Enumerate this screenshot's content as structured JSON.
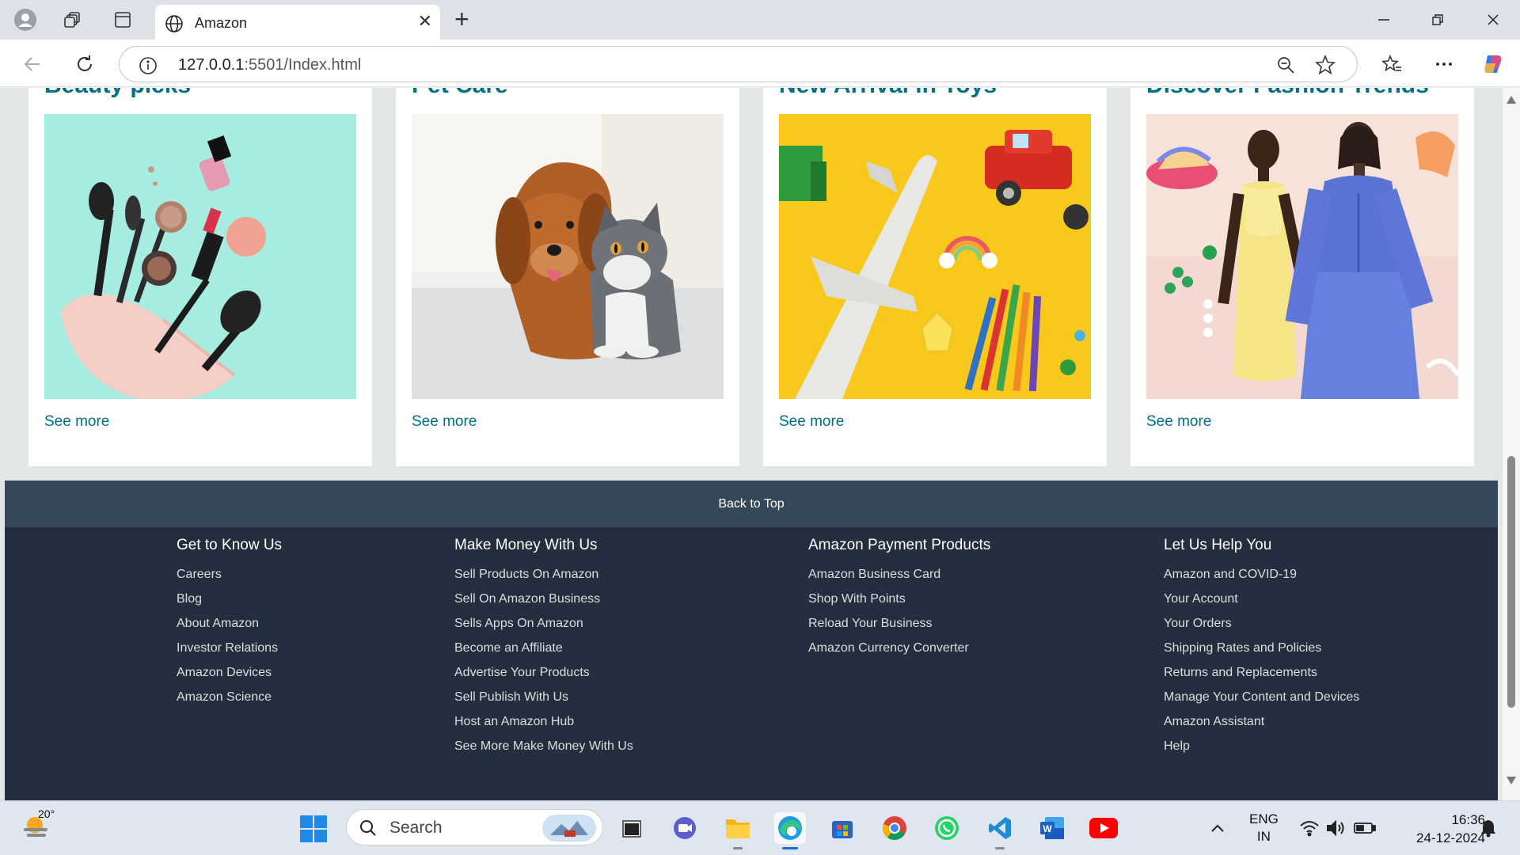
{
  "browser": {
    "tab_title": "Amazon",
    "address": {
      "host": "127.0.0.1",
      "path": ":5501/Index.html"
    }
  },
  "cards": [
    {
      "title": "Beauty picks",
      "link": "See more",
      "image": "cosmetics-photo"
    },
    {
      "title": "Pet Care",
      "link": "See more",
      "image": "dog-and-cat-photo"
    },
    {
      "title": "New Arrival in Toys",
      "link": "See more",
      "image": "toys-photo"
    },
    {
      "title": "Discover Fashion Trends",
      "link": "See more",
      "image": "fashion-photo"
    }
  ],
  "back_to_top": "Back to Top",
  "footer": {
    "columns": [
      {
        "heading": "Get to Know Us",
        "links": [
          "Careers",
          "Blog",
          "About Amazon",
          "Investor Relations",
          "Amazon Devices",
          "Amazon Science"
        ]
      },
      {
        "heading": "Make Money With Us",
        "links": [
          "Sell Products On Amazon",
          "Sell On Amazon Business",
          "Sells Apps On Amazon",
          "Become an Affiliate",
          "Advertise Your Products",
          "Sell Publish With Us",
          "Host an Amazon Hub",
          "See More Make Money With Us"
        ]
      },
      {
        "heading": "Amazon Payment Products",
        "links": [
          "Amazon Business Card",
          "Shop With Points",
          "Reload Your Business",
          "Amazon Currency Converter"
        ]
      },
      {
        "heading": "Let Us Help You",
        "links": [
          "Amazon and COVID-19",
          "Your Account",
          "Your Orders",
          "Shipping Rates and Policies",
          "Returns and Replacements",
          "Manage Your Content and Devices",
          "Amazon Assistant",
          "Help"
        ]
      }
    ]
  },
  "taskbar": {
    "weather_temp": "20°",
    "search_placeholder": "Search",
    "lang_line1": "ENG",
    "lang_line2": "IN",
    "time": "16:36",
    "date": "24-12-2024"
  },
  "colors": {
    "link_teal": "#007185",
    "footer_bg": "#232f3e",
    "back_top_bg": "#37475a"
  }
}
